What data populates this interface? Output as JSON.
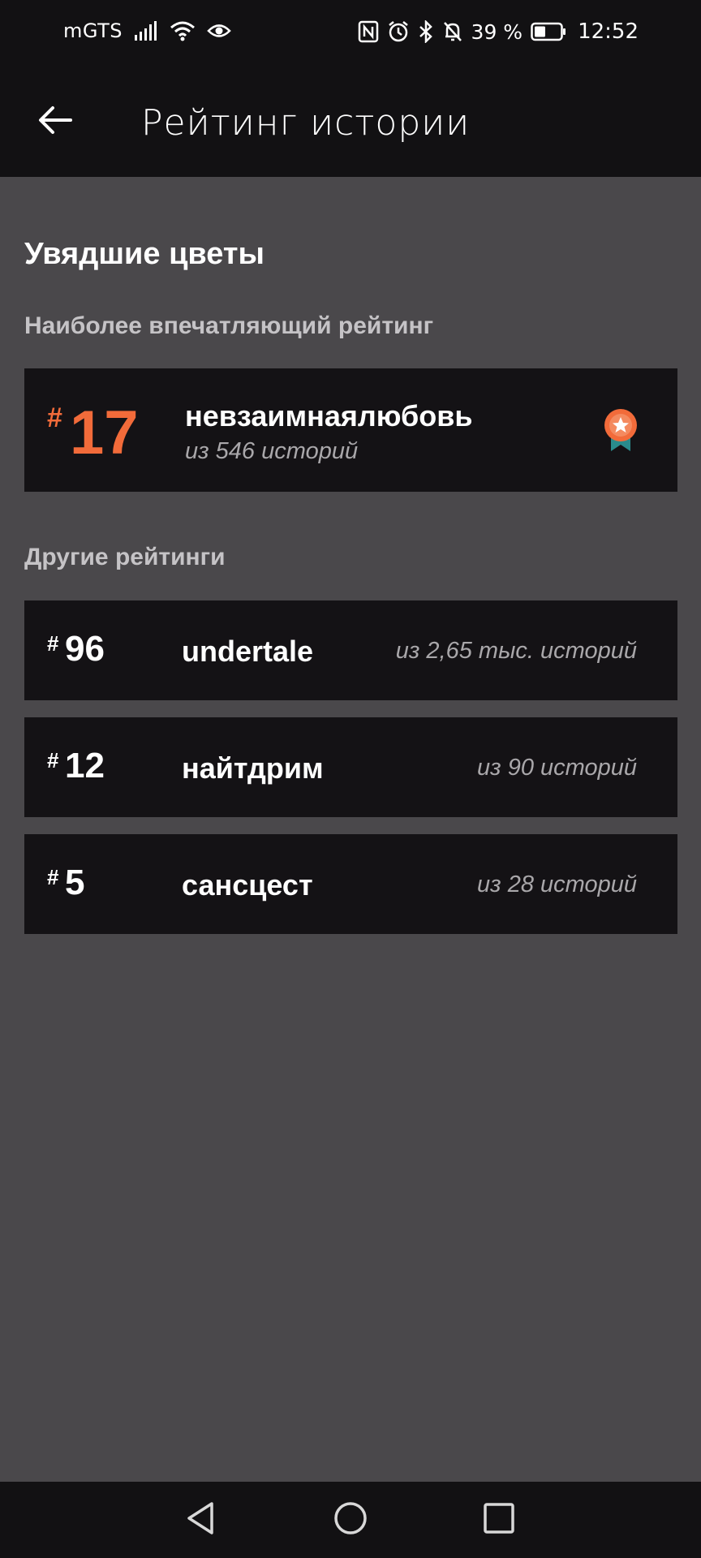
{
  "status_bar": {
    "carrier": "mGTS",
    "battery": "39 %",
    "time": "12:52",
    "icons": [
      "signal-icon",
      "wifi-icon",
      "eye-icon",
      "nfc-icon",
      "alarm-icon",
      "bluetooth-icon",
      "mute-icon",
      "battery-icon"
    ]
  },
  "app_bar": {
    "back_icon": "arrow-left-icon",
    "title": "Рейтинг истории"
  },
  "story": {
    "title": "Увядшие цветы"
  },
  "main_section": {
    "label": "Наиболее впечатляющий рейтинг",
    "featured": {
      "hash": "#",
      "rank": "17",
      "tag": "невзаимнаялюбовь",
      "count": "из 546 историй",
      "badge_icon": "medal-star-icon"
    }
  },
  "other_section": {
    "label": "Другие рейтинги",
    "items": [
      {
        "hash": "#",
        "rank": "96",
        "tag": "undertale",
        "count": "из 2,65 тыс. историй"
      },
      {
        "hash": "#",
        "rank": "12",
        "tag": "найтдрим",
        "count": "из 90 историй"
      },
      {
        "hash": "#",
        "rank": "5",
        "tag": "сансцест",
        "count": "из 28 историй"
      }
    ]
  },
  "nav_bar": {
    "icons": [
      "nav-back-icon",
      "nav-home-icon",
      "nav-recent-icon"
    ]
  },
  "colors": {
    "accent": "#f26b3a",
    "background": "#4a484b",
    "card": "#141215",
    "bar": "#121113",
    "badge_ribbon": "#2a8b8c"
  }
}
